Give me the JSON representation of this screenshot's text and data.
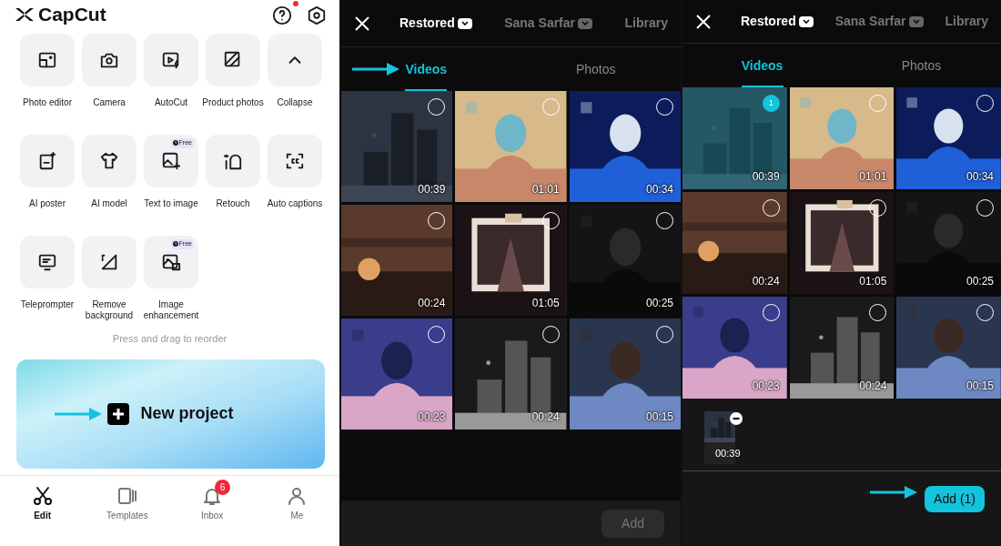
{
  "home": {
    "app_name": "CapCut",
    "help_dot": true,
    "tools": [
      {
        "label": "Photo editor"
      },
      {
        "label": "Camera"
      },
      {
        "label": "AutoCut"
      },
      {
        "label": "Product photos"
      },
      {
        "label": "Collapse"
      },
      {
        "label": "AI poster"
      },
      {
        "label": "AI model"
      },
      {
        "label": "Text to image",
        "badge": "Free"
      },
      {
        "label": "Retouch"
      },
      {
        "label": "Auto captions"
      },
      {
        "label": "Teleprompter"
      },
      {
        "label": "Remove background"
      },
      {
        "label": "Image enhancement",
        "badge": "Free"
      }
    ],
    "hint": "Press and drag to reorder",
    "new_project": {
      "label": "New project",
      "pointer": true
    },
    "nav": [
      {
        "label": "Edit",
        "selected": true
      },
      {
        "label": "Templates",
        "selected": false
      },
      {
        "label": "Inbox",
        "selected": false,
        "badge": "6"
      },
      {
        "label": "Me",
        "selected": false
      }
    ]
  },
  "pickers": [
    {
      "albums": [
        {
          "label": "Restored",
          "selected": true
        },
        {
          "label": "Sana Sarfar",
          "selected": false
        },
        {
          "label": "Library",
          "selected": false
        }
      ],
      "media_tabs": [
        {
          "label": "Videos",
          "selected": true,
          "pointer": true
        },
        {
          "label": "Photos",
          "selected": false,
          "pointer": false
        }
      ],
      "videos": [
        {
          "duration": "00:39",
          "selected": false
        },
        {
          "duration": "01:01",
          "selected": false
        },
        {
          "duration": "00:34",
          "selected": false
        },
        {
          "duration": "00:24",
          "selected": false
        },
        {
          "duration": "01:05",
          "selected": false
        },
        {
          "duration": "00:25",
          "selected": false
        },
        {
          "duration": "00:23",
          "selected": false
        },
        {
          "duration": "00:24",
          "selected": false
        },
        {
          "duration": "00:15",
          "selected": false
        }
      ],
      "add_button": {
        "label": "Add",
        "enabled": false,
        "pointer": false
      }
    },
    {
      "albums": [
        {
          "label": "Restored",
          "selected": true
        },
        {
          "label": "Sana Sarfar",
          "selected": false
        },
        {
          "label": "Library",
          "selected": false
        }
      ],
      "media_tabs": [
        {
          "label": "Videos",
          "selected": true,
          "pointer": false
        },
        {
          "label": "Photos",
          "selected": false,
          "pointer": false
        }
      ],
      "videos": [
        {
          "duration": "00:39",
          "selected": true,
          "order": "1"
        },
        {
          "duration": "01:01",
          "selected": false
        },
        {
          "duration": "00:34",
          "selected": false
        },
        {
          "duration": "00:24",
          "selected": false
        },
        {
          "duration": "01:05",
          "selected": false
        },
        {
          "duration": "00:25",
          "selected": false
        },
        {
          "duration": "00:23",
          "selected": false
        },
        {
          "duration": "00:24",
          "selected": false
        },
        {
          "duration": "00:15",
          "selected": false
        }
      ],
      "tray": [
        {
          "duration": "00:39"
        }
      ],
      "add_button": {
        "label": "Add (1)",
        "enabled": true,
        "pointer": true
      }
    }
  ]
}
